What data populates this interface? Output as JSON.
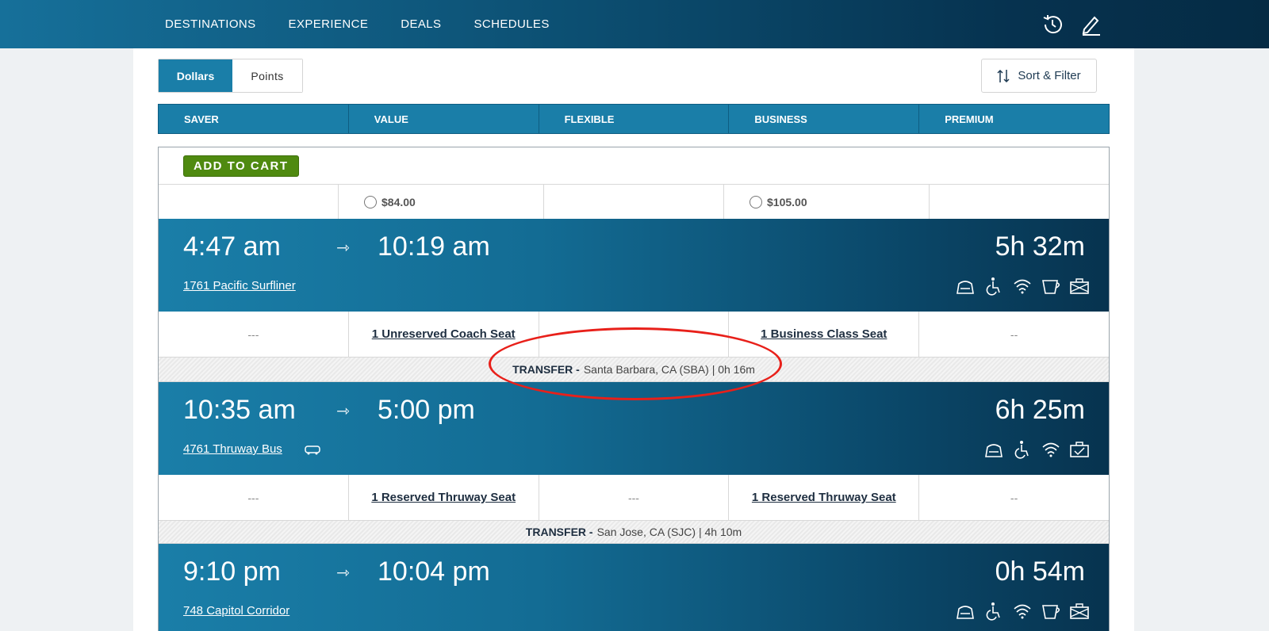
{
  "nav": {
    "links": [
      "DESTINATIONS",
      "EXPERIENCE",
      "DEALS",
      "SCHEDULES"
    ],
    "icons": [
      "history-icon",
      "edit-icon"
    ]
  },
  "toggle": {
    "dollars": "Dollars",
    "points": "Points"
  },
  "sort_filter_label": "Sort & Filter",
  "fare_classes": [
    "SAVER",
    "VALUE",
    "FLEXIBLE",
    "BUSINESS",
    "PREMIUM"
  ],
  "add_to_cart": "ADD TO CART",
  "prices": [
    "",
    "$84.00",
    "",
    "$105.00",
    ""
  ],
  "segments": [
    {
      "depart": "4:47 am",
      "arrive": "10:19 am",
      "duration": "5h 32m",
      "train": "1761 Pacific Surfliner",
      "seats": [
        "---",
        "1 Unreserved Coach Seat",
        "",
        "1 Business Class Seat",
        "--"
      ],
      "transfer_label": "TRANSFER -",
      "transfer_detail": "Santa Barbara, CA (SBA) | 0h 16m"
    },
    {
      "depart": "10:35 am",
      "arrive": "5:00 pm",
      "duration": "6h 25m",
      "train": "4761 Thruway Bus",
      "seats": [
        "---",
        "1 Reserved Thruway Seat",
        "---",
        "1 Reserved Thruway Seat",
        "--"
      ],
      "transfer_label": "TRANSFER -",
      "transfer_detail": "San Jose, CA (SJC) | 4h 10m"
    },
    {
      "depart": "9:10 pm",
      "arrive": "10:04 pm",
      "duration": "0h 54m",
      "train": "748 Capitol Corridor"
    }
  ],
  "colors": {
    "nav_start": "#16709a",
    "nav_end": "#052b44",
    "fare_header": "#1a7ea8",
    "add_to_cart": "#4f8a10",
    "annotation": "#e8201a"
  }
}
